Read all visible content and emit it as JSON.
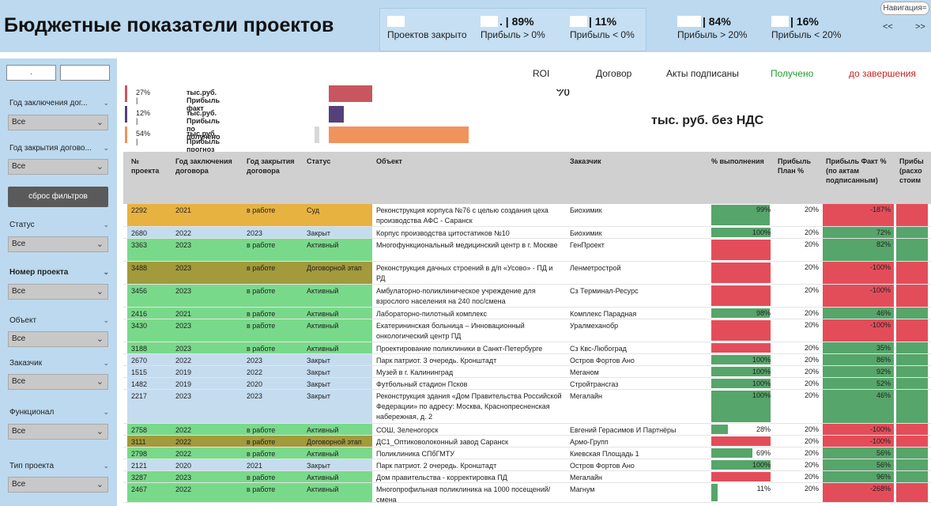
{
  "header": {
    "title": "Бюджетные показатели  проектов",
    "nav_label": "Навигация=",
    "arrow_prev": "<<",
    "arrow_next": ">>",
    "kpis": [
      {
        "value": "",
        "label": "Проектов закрыто"
      },
      {
        "value": ". | 89%",
        "label": "Прибыль > 0%"
      },
      {
        "value": "| 11%",
        "label": "Прибыль < 0%"
      },
      {
        "value": "| 84%",
        "label": "Прибыль > 20%"
      },
      {
        "value": "| 16%",
        "label": "Прибыль < 20%"
      }
    ]
  },
  "sidebar": {
    "search_values": [
      ".",
      ""
    ],
    "reset_label": "сброс фильтров",
    "filters": [
      {
        "label": "Год заключения дог...",
        "value": "Все",
        "bold": false
      },
      {
        "label": "Год закрытия догово...",
        "value": "Все",
        "bold": false
      },
      {
        "label": "Статус",
        "value": "Все",
        "bold": false
      },
      {
        "label": "Номер проекта",
        "value": "Все",
        "bold": true
      },
      {
        "label": "Объект",
        "value": "Все",
        "bold": false
      },
      {
        "label": "Заказчик",
        "value": "Все",
        "bold": false
      },
      {
        "label": "Функционал",
        "value": "Все",
        "bold": false
      },
      {
        "label": "Тип проекта",
        "value": "Все",
        "bold": false
      }
    ]
  },
  "summary": {
    "bars": [
      {
        "pct": "27% |",
        "name": "тыс.руб. Прибыль факт",
        "color": "#c9565f",
        "fraction": 0.31
      },
      {
        "pct": "12% |",
        "name": "тыс.руб. Прибыль по получено",
        "color": "#55407a",
        "fraction": 0.11
      },
      {
        "pct": "54% |",
        "name": "тыс.руб. Прибыль прогноз",
        "color": "#f0935c",
        "fraction": 1.0
      }
    ],
    "cards": [
      {
        "title": "ROI",
        "value": "%",
        "color": "#222"
      },
      {
        "title": "Договор",
        "value": "",
        "color": "#222"
      },
      {
        "title": "Акты подписаны",
        "value": "",
        "color": "#222"
      },
      {
        "title": "Получено",
        "value": "",
        "color": "#1e9e2e"
      },
      {
        "title": "до завершения",
        "value": "",
        "color": "#d42020"
      }
    ],
    "units": "тыс. руб. без НДС"
  },
  "table": {
    "headers": [
      "№\nпроекта",
      "Год заключения\nдоговора",
      "Год закрытия\nдоговора",
      "Статус",
      "Объект",
      "Заказчик",
      "% выполнения",
      "Прибыль\nПлан %",
      "Прибыль Факт %\n(по актам\nподписанным)",
      "Прибы\n(расхо\nстоим"
    ],
    "rows": [
      {
        "id": "2292",
        "y1": "2021",
        "y2": "в работе",
        "status": "Суд",
        "object": "Реконструкция корпуса №76 с целью создания цеха производства АФС - Саранск",
        "customer": "Биохимик",
        "progress": "99%",
        "progress_frac": 0.99,
        "plan": "20%",
        "fact": "-187%",
        "fact_neg": true,
        "color": "#e8b241"
      },
      {
        "id": "2680",
        "y1": "2022",
        "y2": "2023",
        "status": "Закрыт",
        "object": "Корпус производства цитостатиков №10",
        "customer": "Биохимик",
        "progress": "100%",
        "progress_frac": 1.0,
        "plan": "20%",
        "fact": "72%",
        "fact_neg": false,
        "color": "#c5dcef"
      },
      {
        "id": "3363",
        "y1": "2023",
        "y2": "в работе",
        "status": "Активный",
        "object": "Многофункциональный медицинский центр в г. Москве",
        "customer": "ГенПроект",
        "progress": "",
        "progress_frac": 1.0,
        "plan": "20%",
        "fact": "82%",
        "fact_neg": false,
        "color": "#79d98a",
        "progress_red": true
      },
      {
        "id": "3488",
        "y1": "2023",
        "y2": "в работе",
        "status": "Договорной этап",
        "object": "Реконструкция дачных строений в д/п «Усово» - ПД и РД",
        "customer": "Ленметрострой",
        "progress": "",
        "progress_frac": 1.0,
        "plan": "20%",
        "fact": "-100%",
        "fact_neg": true,
        "color": "#a29a3b",
        "progress_red": true
      },
      {
        "id": "3456",
        "y1": "2023",
        "y2": "в работе",
        "status": "Активный",
        "object": "Амбулаторно-поликлиническое учреждение для взрослого населения на 240 пос/смена",
        "customer": "Сз Терминал-Ресурс",
        "progress": "",
        "progress_frac": 1.0,
        "plan": "20%",
        "fact": "-100%",
        "fact_neg": true,
        "color": "#79d98a",
        "progress_red": true
      },
      {
        "id": "2416",
        "y1": "2021",
        "y2": "в работе",
        "status": "Активный",
        "object": "Лабораторно-пилотный комплекс",
        "customer": "Комплекс Парадная",
        "progress": "98%",
        "progress_frac": 0.98,
        "plan": "20%",
        "fact": "46%",
        "fact_neg": false,
        "color": "#79d98a"
      },
      {
        "id": "3430",
        "y1": "2023",
        "y2": "в работе",
        "status": "Активный",
        "object": "Екатерининская больница – Инновационный онкологический центр ПД",
        "customer": "Уралмеханобр",
        "progress": "",
        "progress_frac": 1.0,
        "plan": "20%",
        "fact": "-100%",
        "fact_neg": true,
        "color": "#79d98a",
        "progress_red": true
      },
      {
        "id": "3188",
        "y1": "2023",
        "y2": "в работе",
        "status": "Активный",
        "object": "Проектирование поликлиники в Санкт-Петербурге",
        "customer": "Сз Квс-Любоград",
        "progress": "",
        "progress_frac": 1.0,
        "plan": "20%",
        "fact": "35%",
        "fact_neg": false,
        "color": "#79d98a",
        "progress_red": true
      },
      {
        "id": "2670",
        "y1": "2022",
        "y2": "2023",
        "status": "Закрыт",
        "object": "Парк патриот. 3 очередь. Кронштадт",
        "customer": "Остров Фортов Ано",
        "progress": "100%",
        "progress_frac": 1.0,
        "plan": "20%",
        "fact": "86%",
        "fact_neg": false,
        "color": "#c5dcef"
      },
      {
        "id": "1515",
        "y1": "2019",
        "y2": "2022",
        "status": "Закрыт",
        "object": "Музей в г. Калининград",
        "customer": "Меганом",
        "progress": "100%",
        "progress_frac": 1.0,
        "plan": "20%",
        "fact": "92%",
        "fact_neg": false,
        "color": "#c5dcef"
      },
      {
        "id": "1482",
        "y1": "2019",
        "y2": "2020",
        "status": "Закрыт",
        "object": "Футбольный стадион Псков",
        "customer": "Стройтрансгаз",
        "progress": "100%",
        "progress_frac": 1.0,
        "plan": "20%",
        "fact": "52%",
        "fact_neg": false,
        "color": "#c5dcef"
      },
      {
        "id": "2217",
        "y1": "2023",
        "y2": "2023",
        "status": "Закрыт",
        "object": "Реконструкция здания «Дом Правительства Российской Федерации» по адресу: Москва, Краснопресненская набережная, д. 2",
        "customer": "Мегалайн",
        "progress": "100%",
        "progress_frac": 1.0,
        "plan": "20%",
        "fact": "46%",
        "fact_neg": false,
        "color": "#c5dcef"
      },
      {
        "id": "2758",
        "y1": "2022",
        "y2": "в работе",
        "status": "Активный",
        "object": "СОШ, Зеленогорск",
        "customer": "Евгений Герасимов И Партнёры",
        "progress": "28%",
        "progress_frac": 0.28,
        "plan": "20%",
        "fact": "-100%",
        "fact_neg": true,
        "color": "#79d98a"
      },
      {
        "id": "3111",
        "y1": "2022",
        "y2": "в работе",
        "status": "Договорной этап",
        "object": "ДС1_Оптиковолоконный завод Саранск",
        "customer": "Армо-Групп",
        "progress": "",
        "progress_frac": 1.0,
        "plan": "20%",
        "fact": "-100%",
        "fact_neg": true,
        "color": "#a29a3b",
        "progress_red": true
      },
      {
        "id": "2798",
        "y1": "2022",
        "y2": "в работе",
        "status": "Активный",
        "object": "Поликлиника СПбГМТУ",
        "customer": "Киевская Площадь 1",
        "progress": "69%",
        "progress_frac": 0.69,
        "plan": "20%",
        "fact": "56%",
        "fact_neg": false,
        "color": "#79d98a"
      },
      {
        "id": "2121",
        "y1": "2020",
        "y2": "2021",
        "status": "Закрыт",
        "object": "Парк патриот. 2 очередь. Кронштадт",
        "customer": "Остров Фортов Ано",
        "progress": "100%",
        "progress_frac": 1.0,
        "plan": "20%",
        "fact": "56%",
        "fact_neg": false,
        "color": "#c5dcef"
      },
      {
        "id": "3287",
        "y1": "2023",
        "y2": "в работе",
        "status": "Активный",
        "object": "Дом правительства - корректировка ПД",
        "customer": "Мегалайн",
        "progress": "",
        "progress_frac": 1.0,
        "plan": "20%",
        "fact": "96%",
        "fact_neg": false,
        "color": "#79d98a",
        "progress_red": true
      },
      {
        "id": "2467",
        "y1": "2022",
        "y2": "в работе",
        "status": "Активный",
        "object": "Многопрофильная поликлиника на 1000 посещений/смена",
        "customer": "Магнум",
        "progress": "11%",
        "progress_frac": 0.11,
        "plan": "20%",
        "fact": "-268%",
        "fact_neg": true,
        "color": "#79d98a"
      }
    ]
  }
}
